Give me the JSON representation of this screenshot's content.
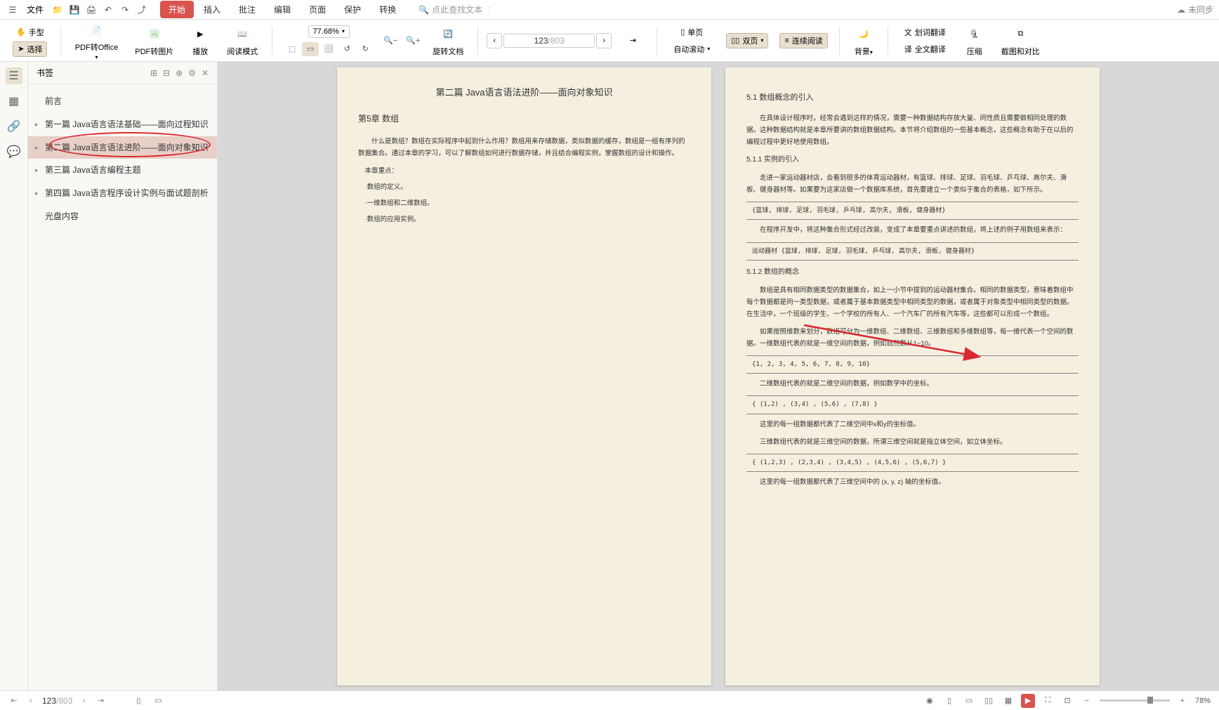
{
  "menu": {
    "file": "文件",
    "tabs": [
      "开始",
      "插入",
      "批注",
      "编辑",
      "页面",
      "保护",
      "转换"
    ],
    "active_tab": 0,
    "search_placeholder": "点此查找文本",
    "sync": "未同步"
  },
  "toolbar": {
    "hand": "手型",
    "select": "选择",
    "pdf_to_office": "PDF转Office",
    "pdf_to_image": "PDF转图片",
    "play": "播放",
    "read_mode": "阅读模式",
    "zoom": "77.68%",
    "rotate": "旋转文档",
    "page_current": "123",
    "page_total": "/803",
    "single_page": "单页",
    "double_page": "双页",
    "continuous": "连续阅读",
    "auto_scroll": "自动滚动",
    "background": "背景",
    "word_translate": "划词翻译",
    "full_translate": "全文翻译",
    "compress": "压缩",
    "screenshot_compare": "截图和对比"
  },
  "bookmarks": {
    "title": "书签",
    "items": [
      {
        "label": "前言",
        "expandable": false
      },
      {
        "label": "第一篇 Java语言语法基础——面向过程知识",
        "expandable": true
      },
      {
        "label": "第二篇 Java语言语法进阶——面向对象知识",
        "expandable": true,
        "active": true
      },
      {
        "label": "第三篇 Java语言编程主题",
        "expandable": true
      },
      {
        "label": "第四篇 Java语言程序设计实例与面试题剖析",
        "expandable": true
      },
      {
        "label": "光盘内容",
        "expandable": false
      }
    ]
  },
  "left_page": {
    "header": "第二篇   Java语言语法进阶——面向对象知识",
    "chapter": "第5章   数组",
    "intro": "什么是数组？数组在实际程序中起到什么作用？数组用来存储数据，类似数据的缓存，数组是一组有序列的数据集合。通过本章的学习，可以了解数组如何进行数据存储，并且结合编程实例，掌握数组的设计和操作。",
    "points_title": "本章重点：",
    "points": [
      "·数组的定义。",
      "·一维数组和二维数组。",
      "·数组的应用实例。"
    ]
  },
  "right_page": {
    "s1": "5.1   数组概念的引入",
    "p1": "在具体设计程序时，经常会遇到这样的情况，需要一种数据结构存放大量、同性质且需要做相同处理的数据。这种数据结构就是本章所要讲的数组数据结构。本节将介绍数组的一些基本概念，这些概念有助于在以后的编程过程中更好地使用数组。",
    "s11": "5.1.1   实例的引入",
    "p2": "走进一家运动器材店，会看到很多的体育运动器材，有篮球、排球、足球、羽毛球、乒乓球、高尔夫、滑板、健身器材等。如果要为这家店做一个数据库系统，首先要建立一个类似于集合的表格，如下所示。",
    "code1": "{篮球, 排球, 足球, 羽毛球, 乒乓球, 高尔夫, 滑板, 健身器材}",
    "p3": "在程序开发中，将这种集合形式经过改装，变成了本章要重点讲述的数组，将上述的例子用数组来表示：",
    "code2": "运动器材 {篮球, 排球, 足球, 羽毛球, 乒乓球, 高尔夫, 滑板, 健身器材}",
    "s12": "5.1.2   数组的概念",
    "p4": "数组是具有相同数据类型的数据集合，如上一小节中提到的运动器材集合。相同的数据类型，意味着数组中每个数据都是同一类型数据，或者属于基本数据类型中相同类型的数据，或者属于对象类型中相同类型的数据。在生活中，一个班级的学生、一个学校的所有人、一个汽车厂的所有汽车等，这些都可以形成一个数组。",
    "p5": "如果按照维数来划分，数组可分为一维数组、二维数组、三维数组和多维数组等，每一维代表一个空间的数据。一维数组代表的就是一维空间的数据，例如自然数从1~10。",
    "code3": "{1, 2, 3, 4, 5, 6, 7, 8, 9, 10}",
    "p6": "二维数组代表的就是二维空间的数据，例如数学中的坐标。",
    "code4": "{  (1,2) ,  (3,4) ,  (5,6) ,  (7,8)  }",
    "p7": "这里的每一组数据都代表了二维空间中x和y的坐标值。",
    "p8": "三维数组代表的就是三维空间的数据，所谓三维空间就是指立体空间，如立体坐标。",
    "code5": "{  (1,2,3) ,  (2,3,4) ,  (3,4,5) ,  (4,5,6) ,  (5,6,7)  }",
    "p9": "这里的每一组数据都代表了三维空间中的 (x, y, z) 轴的坐标值。"
  },
  "statusbar": {
    "page_current": "123",
    "page_total": "/803",
    "zoom": "78%"
  }
}
